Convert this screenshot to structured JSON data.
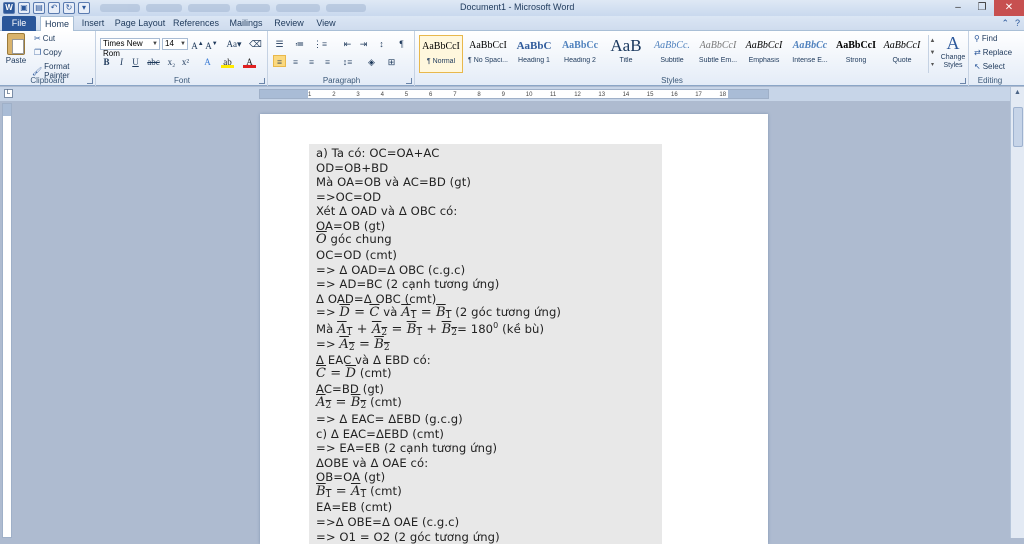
{
  "window": {
    "title": "Document1 - Microsoft Word"
  },
  "tabs": [
    "File",
    "Home",
    "Insert",
    "Page Layout",
    "References",
    "Mailings",
    "Review",
    "View"
  ],
  "clipboard": {
    "paste": "Paste",
    "cut": "Cut",
    "copy": "Copy",
    "format_painter": "Format Painter",
    "label": "Clipboard"
  },
  "font": {
    "name": "Times New Rom",
    "size": "14",
    "label": "Font"
  },
  "paragraph": {
    "label": "Paragraph"
  },
  "styles": {
    "label": "Styles",
    "items": [
      {
        "sample": "AaBbCcI",
        "name": "¶ Normal"
      },
      {
        "sample": "AaBbCcI",
        "name": "¶ No Spaci..."
      },
      {
        "sample": "AaBbC",
        "name": "Heading 1"
      },
      {
        "sample": "AaBbCc",
        "name": "Heading 2"
      },
      {
        "sample": "AaB",
        "name": "Title"
      },
      {
        "sample": "AaBbCc.",
        "name": "Subtitle"
      },
      {
        "sample": "AaBbCcI",
        "name": "Subtle Em..."
      },
      {
        "sample": "AaBbCcI",
        "name": "Emphasis"
      },
      {
        "sample": "AaBbCc",
        "name": "Intense E..."
      },
      {
        "sample": "AaBbCcI",
        "name": "Strong"
      },
      {
        "sample": "AaBbCcI",
        "name": "Quote"
      }
    ],
    "change_styles": "Change Styles"
  },
  "editing": {
    "find": "Find",
    "replace": "Replace",
    "select": "Select",
    "label": "Editing"
  },
  "ruler_ticks": [
    "1",
    "2",
    "3",
    "4",
    "5",
    "6",
    "7",
    "8",
    "9",
    "10",
    "11",
    "12",
    "13",
    "14",
    "15",
    "16",
    "17",
    "18"
  ],
  "doc": {
    "l1": "a) Ta có: OC=OA+AC",
    "l2": "OD=OB+BD",
    "l3": "Mà OA=OB và AC=BD (gt)",
    "l4": "=>OC=OD",
    "l5": "Xét Δ OAD và Δ OBC có:",
    "l6": "OA=OB (gt)",
    "l7_sym": "O",
    "l7_text": " góc chung",
    "l8": "OC=OD (cmt)",
    "l9": "=> Δ OAD=Δ OBC (c.g.c)",
    "l10": "=> AD=BC (2 cạnh tương ứng)",
    "l11": "Δ OAD=Δ OBC (cmt)",
    "l12_pre": "=> ",
    "l12_D": "D",
    "l12_eq": " = ",
    "l12_C": "C",
    "l12_va": " và ",
    "l12_A": "A",
    "l12_1a": "1",
    "l12_B": "B",
    "l12_1b": "1",
    "l12_post": " (2 góc tương ứng)",
    "l13_pre": "Mà ",
    "l13_A1": "A",
    "l13_s1": "1",
    "l13_plus": " + ",
    "l13_A2": "A",
    "l13_s2": "2",
    "l13_eq": " = ",
    "l13_B1": "B",
    "l13_s3": "1",
    "l13_plus2": " + ",
    "l13_B2": "B",
    "l13_s4": "2",
    "l13_val": "= 180",
    "l13_deg": "0",
    "l13_post": " (kề bù)",
    "l14_pre": "=> ",
    "l14_A": "A",
    "l14_s1": "2",
    "l14_eq": " = ",
    "l14_B": "B",
    "l14_s2": "2",
    "l15": "Δ EAC và Δ EBD có:",
    "l16_C": "C",
    "l16_eq": " = ",
    "l16_D": "D",
    "l16_post": " (cmt)",
    "l17": "AC=BD (gt)",
    "l18_A": "A",
    "l18_s1": "2",
    "l18_eq": " = ",
    "l18_B": "B",
    "l18_s2": "2",
    "l18_post": " (cmt)",
    "l19": "=> Δ EAC= ΔEBD (g.c.g)",
    "l20": "c) Δ EAC=ΔEBD (cmt)",
    "l21": "=> EA=EB (2 cạnh tương ứng)",
    "l22": "ΔOBE và Δ OAE có:",
    "l23": "OB=OA (gt)",
    "l24_B": "B",
    "l24_s1": "1",
    "l24_eq": " = ",
    "l24_A": "A",
    "l24_s2": "1",
    "l24_post": " (cmt)",
    "l25": "EA=EB (cmt)",
    "l26": "=>Δ OBE=Δ OAE (c.g.c)",
    "l27": "=> O1 = O2 (2 góc tương ứng)"
  }
}
